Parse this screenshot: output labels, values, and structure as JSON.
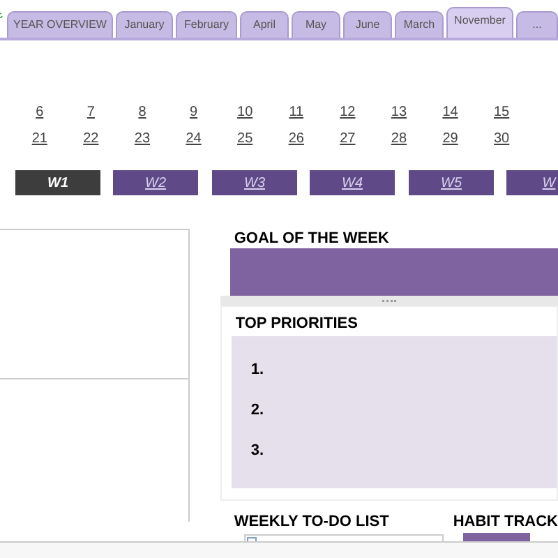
{
  "tabs": [
    {
      "label": "YEAR OVERVIEW",
      "selected": false
    },
    {
      "label": "January",
      "selected": false
    },
    {
      "label": "February",
      "selected": false
    },
    {
      "label": "April",
      "selected": false
    },
    {
      "label": "May",
      "selected": false
    },
    {
      "label": "June",
      "selected": false
    },
    {
      "label": "March",
      "selected": false
    },
    {
      "label": "November",
      "selected": true
    },
    {
      "label": "...",
      "selected": false
    }
  ],
  "dates": [
    [
      "6",
      "7",
      "8",
      "9",
      "10",
      "11",
      "12",
      "13",
      "14",
      "15"
    ],
    [
      "21",
      "22",
      "23",
      "24",
      "25",
      "26",
      "27",
      "28",
      "29",
      "30"
    ]
  ],
  "weeks": [
    {
      "label": "W1",
      "selected": true
    },
    {
      "label": "W2",
      "selected": false
    },
    {
      "label": "W3",
      "selected": false
    },
    {
      "label": "W4",
      "selected": false
    },
    {
      "label": "W5",
      "selected": false
    },
    {
      "label": "W",
      "selected": false
    }
  ],
  "goal": {
    "title": "GOAL OF THE WEEK"
  },
  "priorities": {
    "title": "TOP PRIORITIES",
    "items": [
      "1.",
      "2.",
      "3."
    ]
  },
  "todo": {
    "title": "WEEKLY TO-DO LIST",
    "items": [
      {
        "checked": false
      }
    ]
  },
  "habits": {
    "title": "HABIT TRACK"
  }
}
